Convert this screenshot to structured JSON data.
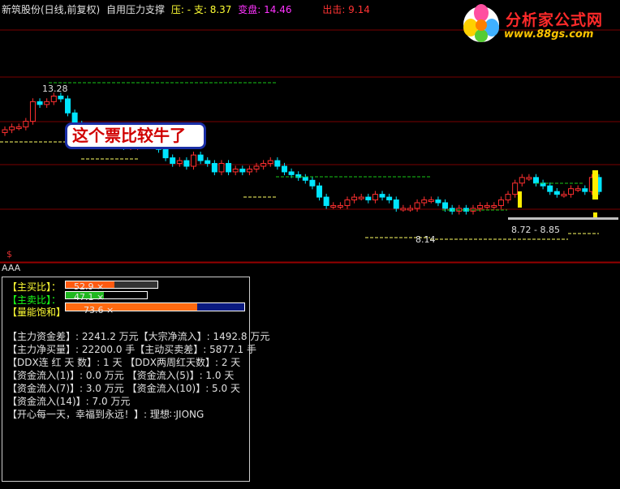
{
  "header": {
    "stock": "新筑股份(日线,前复权)",
    "indicator": "自用压力支撑",
    "ps_label": "压: - 支: 8.37",
    "change_label": "变盘: 14.46",
    "exit_label": "出击: 9.14"
  },
  "logo": {
    "title": "分析家公式网",
    "url": "www.88gs.com"
  },
  "callout": "这个票比较牛了",
  "chart_labels": {
    "high": "13.28",
    "low": "8.14",
    "range": "8.72 - 8.85"
  },
  "price_series": {
    "open": [
      11.9,
      12.0,
      12.1,
      12.1,
      12.3,
      13.0,
      12.9,
      13.0,
      13.2,
      13.1,
      12.6,
      12.2,
      12.0,
      11.8,
      11.7,
      11.6,
      11.6,
      11.5,
      11.4,
      11.4,
      11.6,
      11.6,
      11.6,
      11.3,
      11.0,
      10.8,
      10.9,
      10.7,
      11.1,
      10.9,
      10.8,
      10.5,
      10.8,
      10.5,
      10.6,
      10.5,
      10.6,
      10.7,
      10.8,
      10.9,
      10.7,
      10.5,
      10.4,
      10.3,
      10.2,
      10.0,
      9.6,
      9.3,
      9.3,
      9.3,
      9.5,
      9.6,
      9.6,
      9.5,
      9.7,
      9.6,
      9.5,
      9.2,
      9.2,
      9.2,
      9.4,
      9.5,
      9.5,
      9.4,
      9.2,
      9.1,
      9.2,
      9.1,
      9.2,
      9.3,
      9.3,
      9.3,
      9.5,
      9.7,
      10.1,
      10.3,
      10.3,
      10.1,
      10.0,
      9.8,
      9.7,
      9.7,
      9.9,
      9.9,
      9.8,
      10.3
    ],
    "close": [
      12.0,
      12.1,
      12.1,
      12.3,
      13.0,
      12.9,
      13.0,
      13.2,
      13.1,
      12.6,
      12.2,
      12.0,
      11.8,
      11.7,
      11.6,
      11.6,
      11.5,
      11.4,
      11.4,
      11.6,
      11.6,
      11.6,
      11.3,
      11.0,
      10.8,
      10.9,
      10.7,
      11.1,
      10.9,
      10.8,
      10.5,
      10.8,
      10.5,
      10.6,
      10.5,
      10.6,
      10.7,
      10.8,
      10.9,
      10.7,
      10.5,
      10.4,
      10.3,
      10.2,
      10.0,
      9.6,
      9.3,
      9.3,
      9.3,
      9.5,
      9.6,
      9.6,
      9.5,
      9.7,
      9.6,
      9.5,
      9.2,
      9.2,
      9.2,
      9.4,
      9.5,
      9.5,
      9.4,
      9.2,
      9.1,
      9.2,
      9.1,
      9.2,
      9.3,
      9.3,
      9.3,
      9.5,
      9.7,
      10.1,
      10.3,
      10.3,
      10.1,
      10.0,
      9.8,
      9.7,
      9.7,
      9.9,
      9.9,
      9.8,
      10.3,
      9.8
    ]
  },
  "indicators": {
    "main_buy": {
      "label": "【主买比】：",
      "value": "52.9  ×",
      "fraction": 0.529,
      "color": "#ff5a10"
    },
    "main_sell": {
      "label": "【主卖比】：",
      "value": "47.1  ×",
      "fraction": 0.471,
      "color": "#1fb71f"
    },
    "saturation": {
      "label": "【量能饱和】",
      "value": "73.6  ×",
      "fraction": 0.736,
      "color": "#ff6a10",
      "rest_color": "#0a1a80"
    },
    "rows": [
      "【主力资金差】: 2241.2 万元【大宗净流入】: 1492.8 万元",
      "【主力净买量】: 22200.0 手【主动买卖差】: 5877.1 手",
      "【DDX连 红 天 数】: 1 天    【DDX两周红天数】: 2 天",
      "【资金流入(1)】: 0.0 万元     【资金流入(5)】: 1.0 天",
      "【资金流入(7)】: 3.0 万元     【资金流入(10)】: 5.0 天",
      "【资金流入(14)】: 7.0 万元",
      "【开心每一天，幸福到永远！】: 理想∷JIONG"
    ]
  },
  "sub_label": "AAA",
  "dollar_mark": "$",
  "colors": {
    "up": "#ff3030",
    "down": "#00e5ff",
    "grid": "#7a0000",
    "support": "#ffff66",
    "resist": "#19c819"
  }
}
